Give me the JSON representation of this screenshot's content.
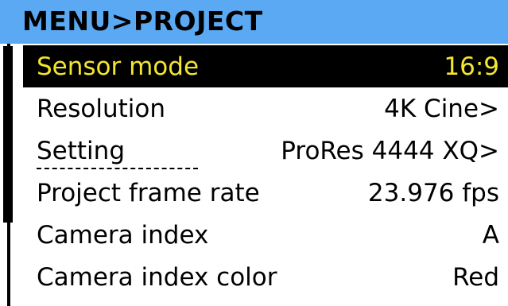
{
  "header": {
    "title": "MENU>PROJECT"
  },
  "menu": {
    "items": [
      {
        "label": "Sensor mode",
        "value": "16:9",
        "selected": true
      },
      {
        "label": "Resolution",
        "value": "4K Cine>"
      },
      {
        "label": "Setting",
        "value": "ProRes 4444 XQ>"
      },
      {
        "label": "Project frame rate",
        "value": "23.976 fps"
      },
      {
        "label": "Camera index",
        "value": "A"
      },
      {
        "label": "Camera index color",
        "value": "Red"
      }
    ]
  },
  "colors": {
    "header_bg": "#5aa9f2",
    "selected_bg": "#000000",
    "selected_text": "#f2e72e",
    "page_bg": "#ffffff"
  }
}
